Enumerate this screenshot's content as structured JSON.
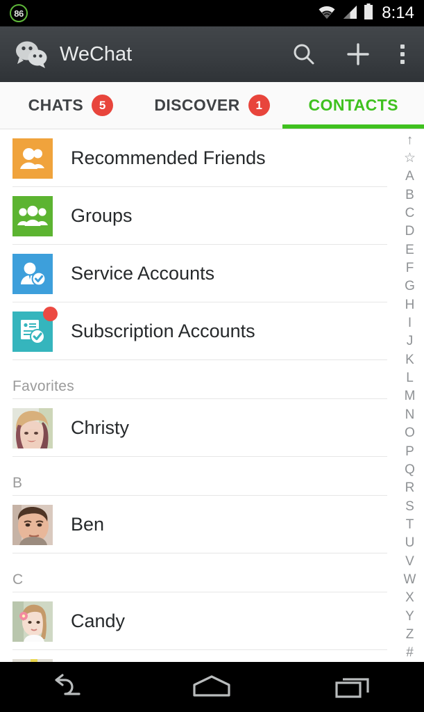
{
  "status_bar": {
    "charge_badge": "86",
    "time": "8:14",
    "icons": [
      "wifi-icon",
      "cellular-signal-icon",
      "battery-icon"
    ]
  },
  "action_bar": {
    "logo": "wechat-logo",
    "title": "WeChat",
    "actions": [
      {
        "name": "search-icon",
        "label": "Search"
      },
      {
        "name": "add-icon",
        "label": "Add"
      },
      {
        "name": "overflow-menu-icon",
        "label": "More options"
      }
    ]
  },
  "tabs": [
    {
      "label": "CHATS",
      "badge": "5",
      "active": false
    },
    {
      "label": "DISCOVER",
      "badge": "1",
      "active": false
    },
    {
      "label": "CONTACTS",
      "badge": "",
      "active": true
    }
  ],
  "shortcuts": [
    {
      "label": "Recommended Friends",
      "icon": "two-people-icon",
      "color": "#F0A33C",
      "badge": false
    },
    {
      "label": "Groups",
      "icon": "three-people-icon",
      "color": "#5CB431",
      "badge": false
    },
    {
      "label": "Service Accounts",
      "icon": "verified-person-icon",
      "color": "#3D9FDB",
      "badge": false
    },
    {
      "label": "Subscription Accounts",
      "icon": "verified-document-icon",
      "color": "#35B5BD",
      "badge": true
    }
  ],
  "sections": [
    {
      "header": "Favorites",
      "contacts": [
        {
          "name": "Christy",
          "avatar": "photo-avatar-christy"
        }
      ]
    },
    {
      "header": "B",
      "contacts": [
        {
          "name": "Ben",
          "avatar": "photo-avatar-ben"
        }
      ]
    },
    {
      "header": "C",
      "contacts": [
        {
          "name": "Candy",
          "avatar": "photo-avatar-candy"
        }
      ]
    }
  ],
  "az_index": [
    "↑",
    "☆",
    "A",
    "B",
    "C",
    "D",
    "E",
    "F",
    "G",
    "H",
    "I",
    "J",
    "K",
    "L",
    "M",
    "N",
    "O",
    "P",
    "Q",
    "R",
    "S",
    "T",
    "U",
    "V",
    "W",
    "X",
    "Y",
    "Z",
    "#"
  ],
  "nav_bar": [
    {
      "name": "back-button",
      "label": "Back"
    },
    {
      "name": "home-button",
      "label": "Home"
    },
    {
      "name": "recents-button",
      "label": "Recents"
    }
  ],
  "colors": {
    "accent_green": "#3FC11F",
    "badge_red": "#E8453C",
    "action_bar": "#3A3E42",
    "status_bar": "#000000",
    "list_bg": "#FFFFFF"
  }
}
